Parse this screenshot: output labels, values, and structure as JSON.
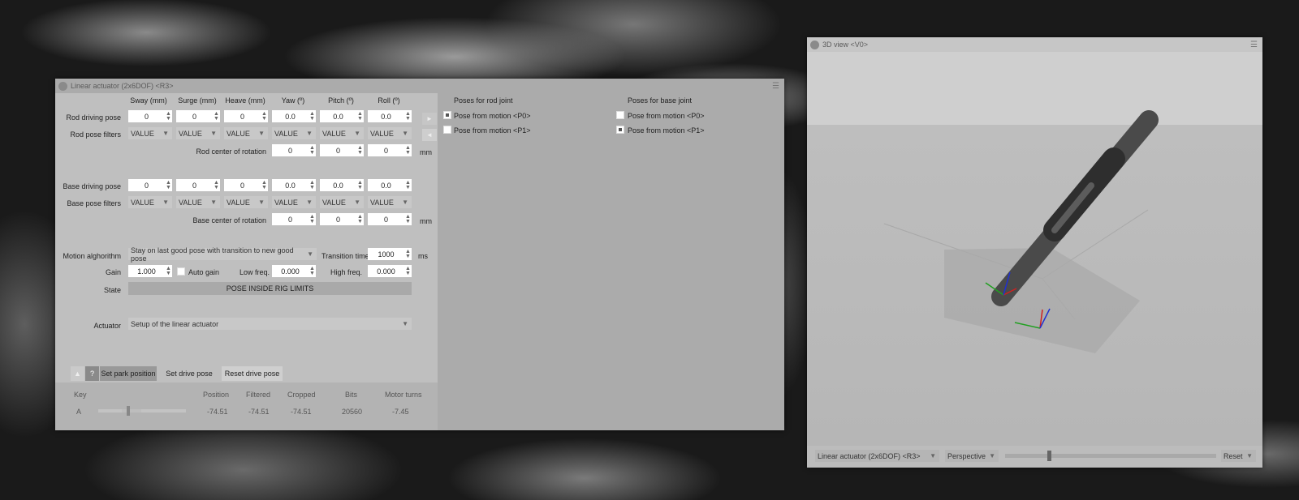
{
  "main_window": {
    "title": "Linear actuator (2x6DOF) <R3>",
    "columns": [
      "Sway (mm)",
      "Surge (mm)",
      "Heave (mm)",
      "Yaw (º)",
      "Pitch (º)",
      "Roll (º)"
    ],
    "rod_driving_pose": {
      "label": "Rod driving pose",
      "values": [
        "0",
        "0",
        "0",
        "0.0",
        "0.0",
        "0.0"
      ]
    },
    "rod_pose_filters": {
      "label": "Rod pose filters",
      "values": [
        "VALUE",
        "VALUE",
        "VALUE",
        "VALUE",
        "VALUE",
        "VALUE"
      ]
    },
    "rod_center": {
      "label": "Rod center of rotation",
      "values": [
        "0",
        "0",
        "0"
      ],
      "unit": "mm"
    },
    "base_driving_pose": {
      "label": "Base driving pose",
      "values": [
        "0",
        "0",
        "0",
        "0.0",
        "0.0",
        "0.0"
      ]
    },
    "base_pose_filters": {
      "label": "Base pose filters",
      "values": [
        "VALUE",
        "VALUE",
        "VALUE",
        "VALUE",
        "VALUE",
        "VALUE"
      ]
    },
    "base_center": {
      "label": "Base center of rotation",
      "values": [
        "0",
        "0",
        "0"
      ],
      "unit": "mm"
    },
    "motion": {
      "label": "Motion alghorithm",
      "value": "Stay on last good pose with transition to new good pose",
      "transition_label": "Transition time",
      "transition_value": "1000",
      "transition_unit": "ms"
    },
    "gain": {
      "label": "Gain",
      "value": "1.000",
      "auto_gain_label": "Auto gain",
      "low_freq_label": "Low freq.",
      "low_freq_value": "0.000",
      "high_freq_label": "High freq.",
      "high_freq_value": "0.000"
    },
    "state": {
      "label": "State",
      "value": "POSE INSIDE RIG LIMITS"
    },
    "actuator": {
      "label": "Actuator",
      "value": "Setup of the linear actuator"
    },
    "buttons": {
      "up": "▲",
      "help": "?",
      "set_park": "Set park position",
      "set_drive": "Set drive pose",
      "reset_drive": "Reset drive pose"
    },
    "table": {
      "headers": [
        "Key",
        "Position",
        "Filtered",
        "Cropped",
        "Bits",
        "Motor turns"
      ],
      "row": {
        "key": "A",
        "position": "-74.51",
        "filtered": "-74.51",
        "cropped": "-74.51",
        "bits": "20560",
        "motor_turns": "-7.45",
        "slider_fraction": 0.32
      }
    },
    "side_arrows": {
      "right": "►",
      "left": "◄"
    },
    "rod_joint": {
      "title": "Poses for rod joint",
      "items": [
        {
          "label": "Pose from motion <P0>",
          "checked": true
        },
        {
          "label": "Pose from motion <P1>",
          "checked": false
        }
      ]
    },
    "base_joint": {
      "title": "Poses for base joint",
      "items": [
        {
          "label": "Pose from motion <P0>",
          "checked": false
        },
        {
          "label": "Pose from motion <P1>",
          "checked": true
        }
      ]
    }
  },
  "view_window": {
    "title": "3D view <V0>",
    "source": "Linear actuator (2x6DOF) <R3>",
    "projection": "Perspective",
    "zoom_fraction": 0.2,
    "reset": "Reset"
  },
  "colors": {
    "axis_x": "#d02020",
    "axis_y": "#20a020",
    "axis_z": "#2030d0"
  }
}
